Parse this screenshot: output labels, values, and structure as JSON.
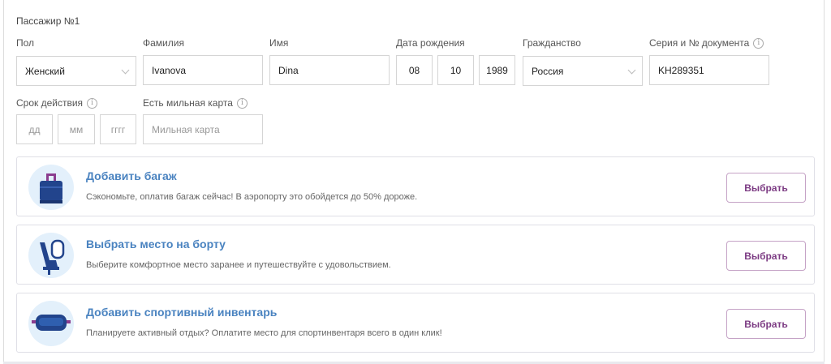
{
  "passenger": {
    "title": "Пассажир №1",
    "gender": {
      "label": "Пол",
      "value": "Женский"
    },
    "surname": {
      "label": "Фамилия",
      "value": "Ivanova"
    },
    "name": {
      "label": "Имя",
      "value": "Dina"
    },
    "birth": {
      "label": "Дата рождения",
      "day": "08",
      "month": "10",
      "year": "1989"
    },
    "citizenship": {
      "label": "Гражданство",
      "value": "Россия"
    },
    "document": {
      "label": "Серия и № документа",
      "value": "KH289351"
    },
    "validity": {
      "label": "Срок действия",
      "day_placeholder": "дд",
      "month_placeholder": "мм",
      "year_placeholder": "гггг"
    },
    "miles": {
      "label": "Есть мильная карта",
      "placeholder": "Мильная карта"
    }
  },
  "services": [
    {
      "title": "Добавить багаж",
      "description": "Сэкономьте, оплатив багаж сейчас! В аэропорту это обойдется до 50% дороже.",
      "button": "Выбрать",
      "icon": "baggage-icon"
    },
    {
      "title": "Выбрать место на борту",
      "description": "Выберите комфортное место заранее и путешествуйте с удовольствием.",
      "button": "Выбрать",
      "icon": "seat-icon"
    },
    {
      "title": "Добавить спортивный инвентарь",
      "description": "Планируете активный отдых? Оплатите место для спортинвентаря всего в один клик!",
      "button": "Выбрать",
      "icon": "ski-goggles-icon"
    }
  ],
  "colors": {
    "title_blue": "#4a83c0",
    "button_purple": "#7c3b83",
    "icon_bg": "#e3f0fb"
  },
  "info_glyph": "i"
}
